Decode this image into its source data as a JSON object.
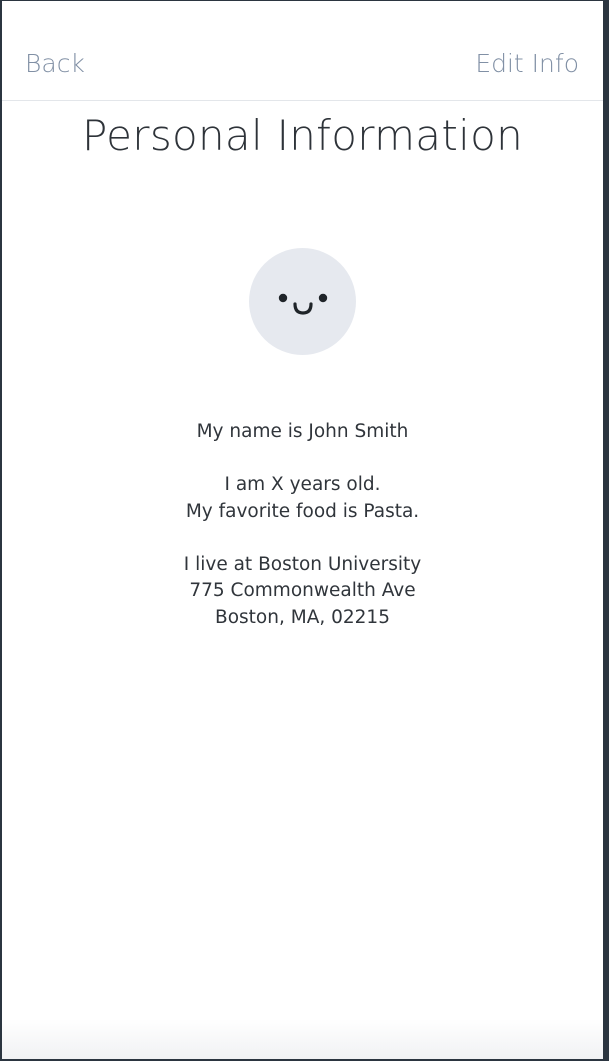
{
  "nav": {
    "back_label": "Back",
    "edit_label": "Edit Info"
  },
  "page": {
    "title": "Personal Information"
  },
  "avatar": {
    "icon": "smiley-face-icon",
    "background": "#e6e9ef"
  },
  "profile": {
    "name_line": "My name is John Smith",
    "age_line": "I am X years old.",
    "food_line": "My favorite food is Pasta.",
    "address_line1": "I live at Boston University",
    "address_line2": "775 Commonwealth Ave",
    "address_line3": "Boston, MA, 02215"
  },
  "colors": {
    "nav_text": "#8190a5",
    "title_text": "#2e3339",
    "body_text": "#30353b",
    "frame": "#2b3540"
  }
}
